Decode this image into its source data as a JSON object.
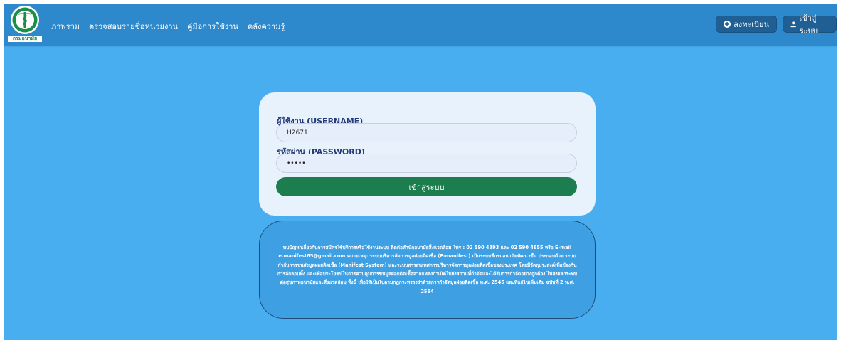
{
  "logo": {
    "text": "กรมอนามัย"
  },
  "nav": {
    "links": [
      "ภาพรวม",
      "ตรวจสอบรายชื่อหน่วยงาน",
      "คู่มือการใช้งาน",
      "คลังความรู้"
    ],
    "register_label": "ลงทะเบียน",
    "login_label": "เข้าสู่ระบบ"
  },
  "form": {
    "username_label": "ผู้ใช้งาน (USERNAME)",
    "username_value": "H2671",
    "password_label": "รหัสผ่าน (PASSWORD)",
    "password_value": "•••••",
    "submit_label": "เข้าสู่ระบบ"
  },
  "info": {
    "text": "พบปัญหาเกี่ยวกับการสมัครใช้บริการหรือใช้งานระบบ ติดต่อสำนักอนามัยสิ่งแวดล้อม โทร : 02 590 4393 และ 02 590 4655 หรือ E-mail e.manifest65@gmail.com หมายเหตุ: ระบบบริหารจัดการมูลฝอยติดเชื้อ (E-manifest) เป็นระบบที่กรมอนามัยพัฒนาขึ้น ประกอบด้วย ระบบกำกับการขนส่งมูลฝอยติดเชื้อ (Manifest System) และระบบสารสนเทศการบริหารจัดการมูลฝอยติดเชื้อของประเทศ โดยมีวัตถุประสงค์เพื่อป้องกันการลักลอบทิ้ง และเพื่อประโยชน์ในการควบคุมการขนมูลฝอยติดเชื้อจากแหล่งกำเนิดไปยังสถานที่กำจัดและได้รับการกำจัดอย่างถูกต้อง ไม่ส่งผลกระทบต่อสุขภาพอนามัยและสิ่งแวดล้อม ทั้งนี้ เพื่อให้เป็นไปตามกฎกระทรวงว่าด้วยการกำจัดมูลฝอยติดเชื้อ พ.ศ. 2545 และที่แก้ไขเพิ่มเติม ฉบับที่ 2 พ.ศ. 2564"
  },
  "colors": {
    "page_bg": "#48aef0",
    "navbar_bg": "#2d89cc",
    "submit_bg": "#1c7e4e",
    "label_color": "#233a78"
  }
}
